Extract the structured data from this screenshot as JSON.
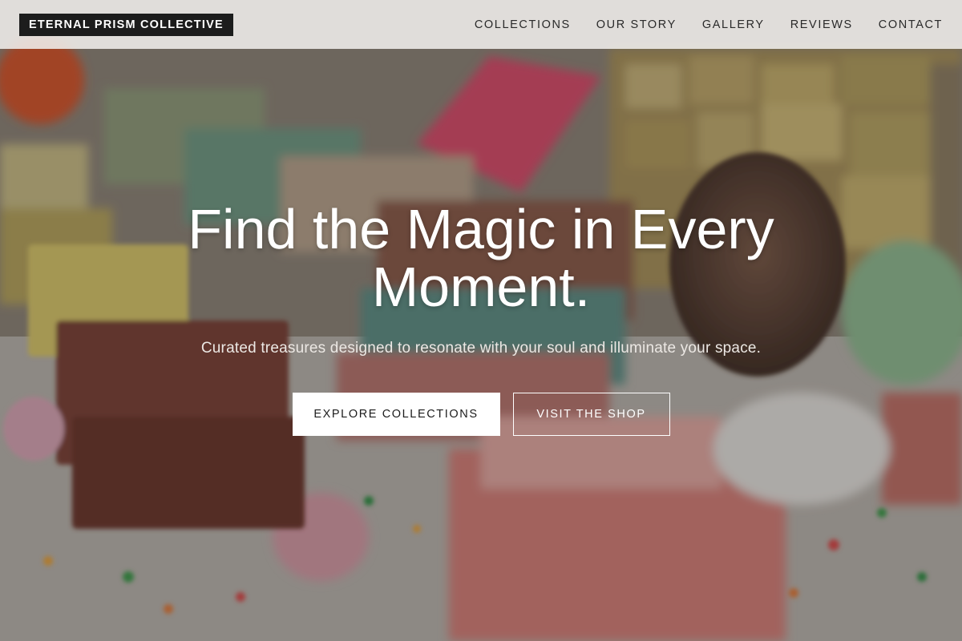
{
  "brand": {
    "name": "ETERNAL PRISM COLLECTIVE"
  },
  "nav": {
    "items": [
      {
        "label": "COLLECTIONS"
      },
      {
        "label": "OUR STORY"
      },
      {
        "label": "GALLERY"
      },
      {
        "label": "REVIEWS"
      },
      {
        "label": "CONTACT"
      }
    ]
  },
  "hero": {
    "title": "Find the Magic in Every Moment.",
    "subtitle": "Curated treasures designed to resonate with your soul and illuminate your space.",
    "primary_button": "EXPLORE COLLECTIONS",
    "secondary_button": "VISIT THE SHOP",
    "background_image": "handmade soap bars, pinecone and colorful sprinkles on a table"
  },
  "colors": {
    "brand_badge_bg": "#1c1c1c",
    "navbar_bg": "#f0eeec",
    "primary_button_bg": "#ffffff",
    "hero_text": "#ffffff"
  }
}
